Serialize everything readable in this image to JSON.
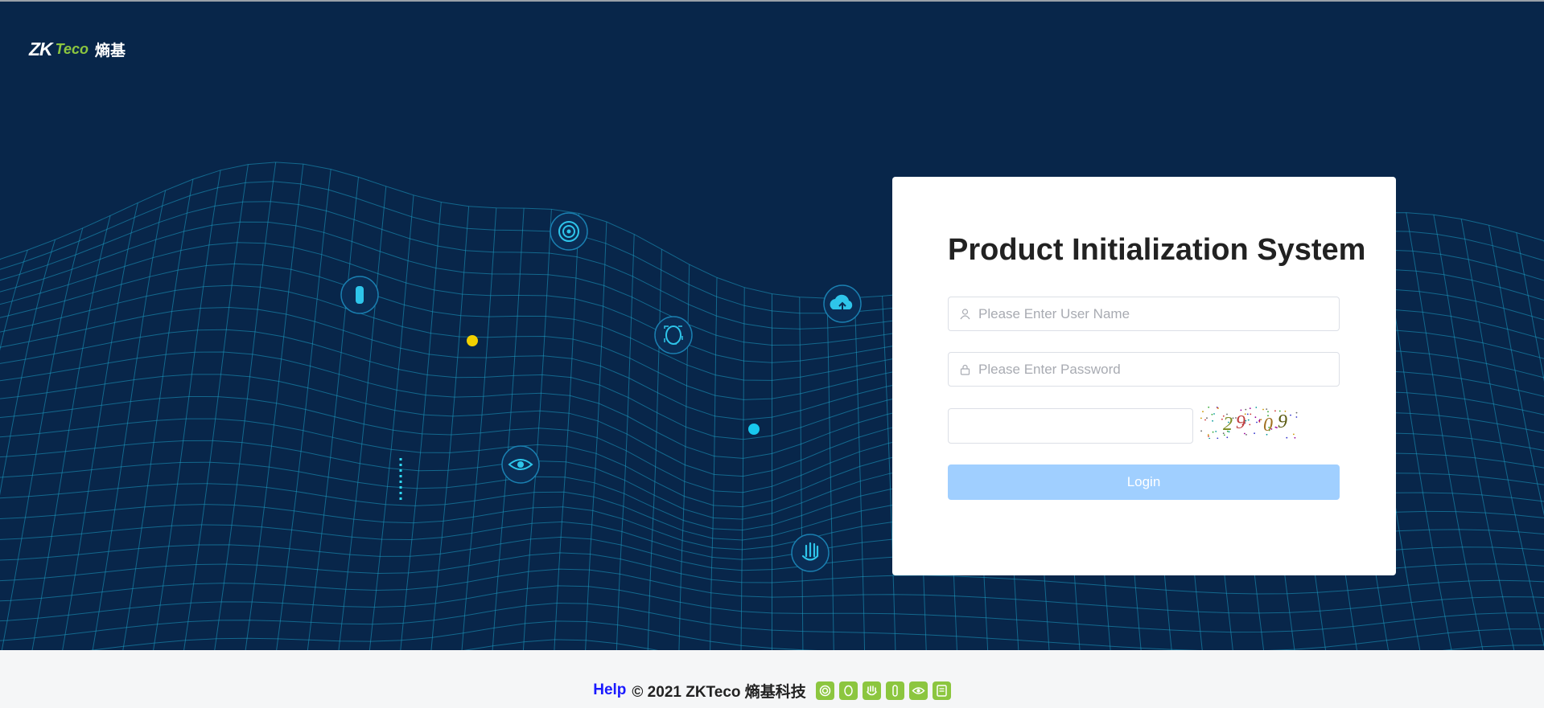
{
  "brand": {
    "logo_main": "ZK",
    "logo_sub": "Teco",
    "logo_cn": "熵基",
    "accent_color": "#8cc63f"
  },
  "login": {
    "title": "Product Initialization System",
    "username_placeholder": "Please Enter User Name",
    "password_placeholder": "Please Enter Password",
    "captcha_value": "",
    "captcha_text": "2909",
    "login_label": "Login",
    "button_color": "#a0cfff"
  },
  "footer": {
    "help_label": "Help",
    "copyright": "© 2021 ZKTeco 熵基科技",
    "icons": [
      "fingerprint-icon",
      "face-icon",
      "palm-icon",
      "finger-vein-icon",
      "iris-icon",
      "card-icon"
    ]
  },
  "hero_icons": [
    "finger-vein-icon",
    "fingerprint-icon",
    "face-icon",
    "cloud-upload-icon",
    "iris-icon",
    "palm-icon"
  ]
}
